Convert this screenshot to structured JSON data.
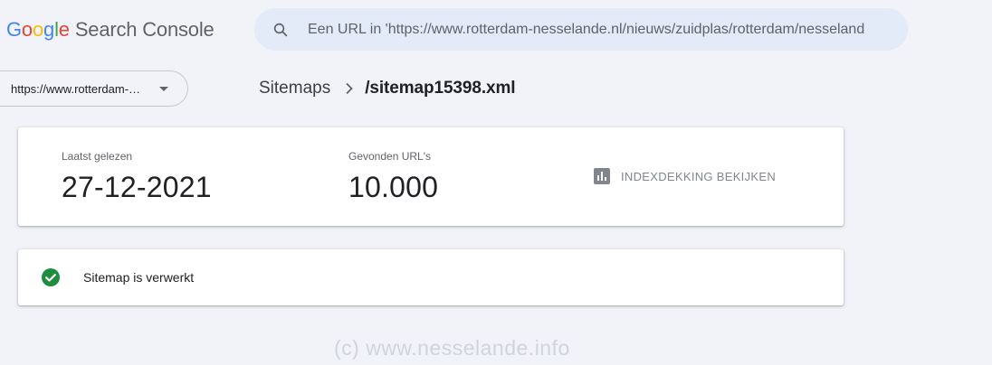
{
  "header": {
    "logo": {
      "g1": "G",
      "o1": "o",
      "o2": "o",
      "g2": "g",
      "l": "l",
      "e": "e",
      "product": "Search Console"
    },
    "search_placeholder": "Een URL in 'https://www.rotterdam-nesselande.nl/nieuws/zuidplas/rotterdam/nesselande' inspecteren"
  },
  "property_selector": {
    "label": "https://www.rotterdam-nesselande.nl/"
  },
  "breadcrumb": {
    "parent": "Sitemaps",
    "current": "/sitemap15398.xml"
  },
  "stats": {
    "last_read_label": "Laatst gelezen",
    "last_read_value": "27-12-2021",
    "found_urls_label": "Gevonden URL's",
    "found_urls_value": "10.000",
    "coverage_button": "INDEXDEKKING BEKIJKEN"
  },
  "status": {
    "text": "Sitemap is verwerkt"
  },
  "watermark": "(c)  www.nesselande.info",
  "colors": {
    "background": "#f1f3f8",
    "search_bg": "#e3eaf8",
    "success": "#1e8e3e",
    "muted": "#80868b"
  },
  "icons": [
    "search-icon",
    "dropdown-caret-icon",
    "chevron-right-icon",
    "bar-chart-icon",
    "check-circle-icon"
  ]
}
